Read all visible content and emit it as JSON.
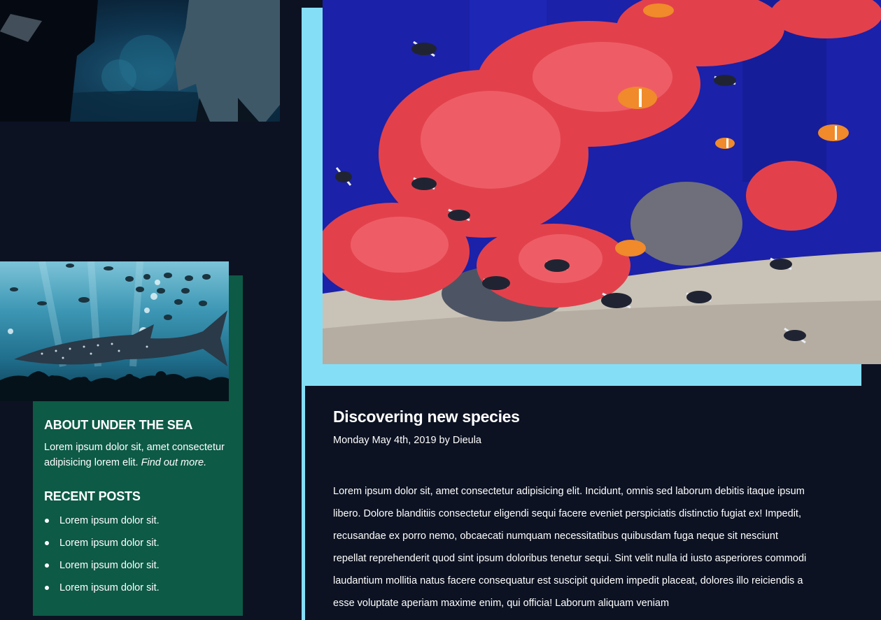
{
  "article": {
    "title": "Discovering new species",
    "meta": "Monday May 4th, 2019 by Dieula",
    "body": "Lorem ipsum dolor sit, amet consectetur adipisicing elit. Incidunt, omnis sed laborum debitis itaque ipsum libero. Dolore blanditiis consectetur eligendi sequi facere eveniet perspiciatis distinctio fugiat ex! Impedit, recusandae ex porro nemo, obcaecati numquam necessitatibus quibusdam fuga neque sit nesciunt repellat reprehenderit quod sint ipsum doloribus tenetur sequi. Sint velit nulla id iusto asperiores commodi laudantium mollitia natus facere consequatur est suscipit quidem impedit placeat, dolores illo reiciendis a esse voluptate aperiam maxime enim, qui officia! Laborum aliquam veniam"
  },
  "sidebar": {
    "about_heading": "ABOUT UNDER THE SEA",
    "about_text": "Lorem ipsum dolor sit, amet consectetur adipisicing lorem elit.",
    "about_link": "Find out more.",
    "recent_heading": "RECENT POSTS",
    "recent_posts": [
      "Lorem ipsum dolor sit.",
      "Lorem ipsum dolor sit.",
      "Lorem ipsum dolor sit.",
      "Lorem ipsum dolor sit."
    ]
  },
  "colors": {
    "background": "#0c1222",
    "accent_cyan": "#84dff6",
    "sidebar_green": "#0d5a46"
  }
}
